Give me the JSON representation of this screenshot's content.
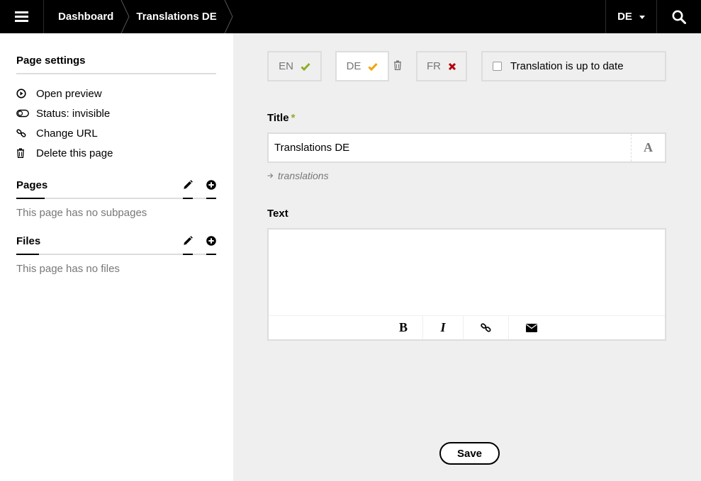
{
  "topbar": {
    "breadcrumbs": [
      {
        "label": "Dashboard"
      },
      {
        "label": "Translations DE"
      }
    ],
    "language": "DE"
  },
  "sidebar": {
    "page_settings": {
      "title": "Page settings",
      "actions": [
        {
          "label": "Open preview",
          "icon": "play-circle-icon"
        },
        {
          "label": "Status: invisible",
          "icon": "toggle-off-icon"
        },
        {
          "label": "Change URL",
          "icon": "link-icon"
        },
        {
          "label": "Delete this page",
          "icon": "trash-icon"
        }
      ]
    },
    "pages": {
      "title": "Pages",
      "empty": "This page has no subpages"
    },
    "files": {
      "title": "Files",
      "empty": "This page has no files"
    }
  },
  "main": {
    "languages": [
      {
        "code": "EN",
        "status": "complete",
        "status_color": "#8dae28"
      },
      {
        "code": "DE",
        "status": "outdated",
        "status_color": "#f0a500",
        "active": true
      },
      {
        "code": "FR",
        "status": "missing",
        "status_color": "#b3000a"
      }
    ],
    "uptodate_label": "Translation is up to date",
    "uptodate_checked": false,
    "title_field": {
      "label": "Title",
      "required_mark": "*",
      "value": "Translations DE"
    },
    "slug": "translations",
    "text_field": {
      "label": "Text",
      "value": ""
    },
    "toolbar": {
      "bold": "B",
      "italic": "I"
    },
    "save_label": "Save"
  }
}
